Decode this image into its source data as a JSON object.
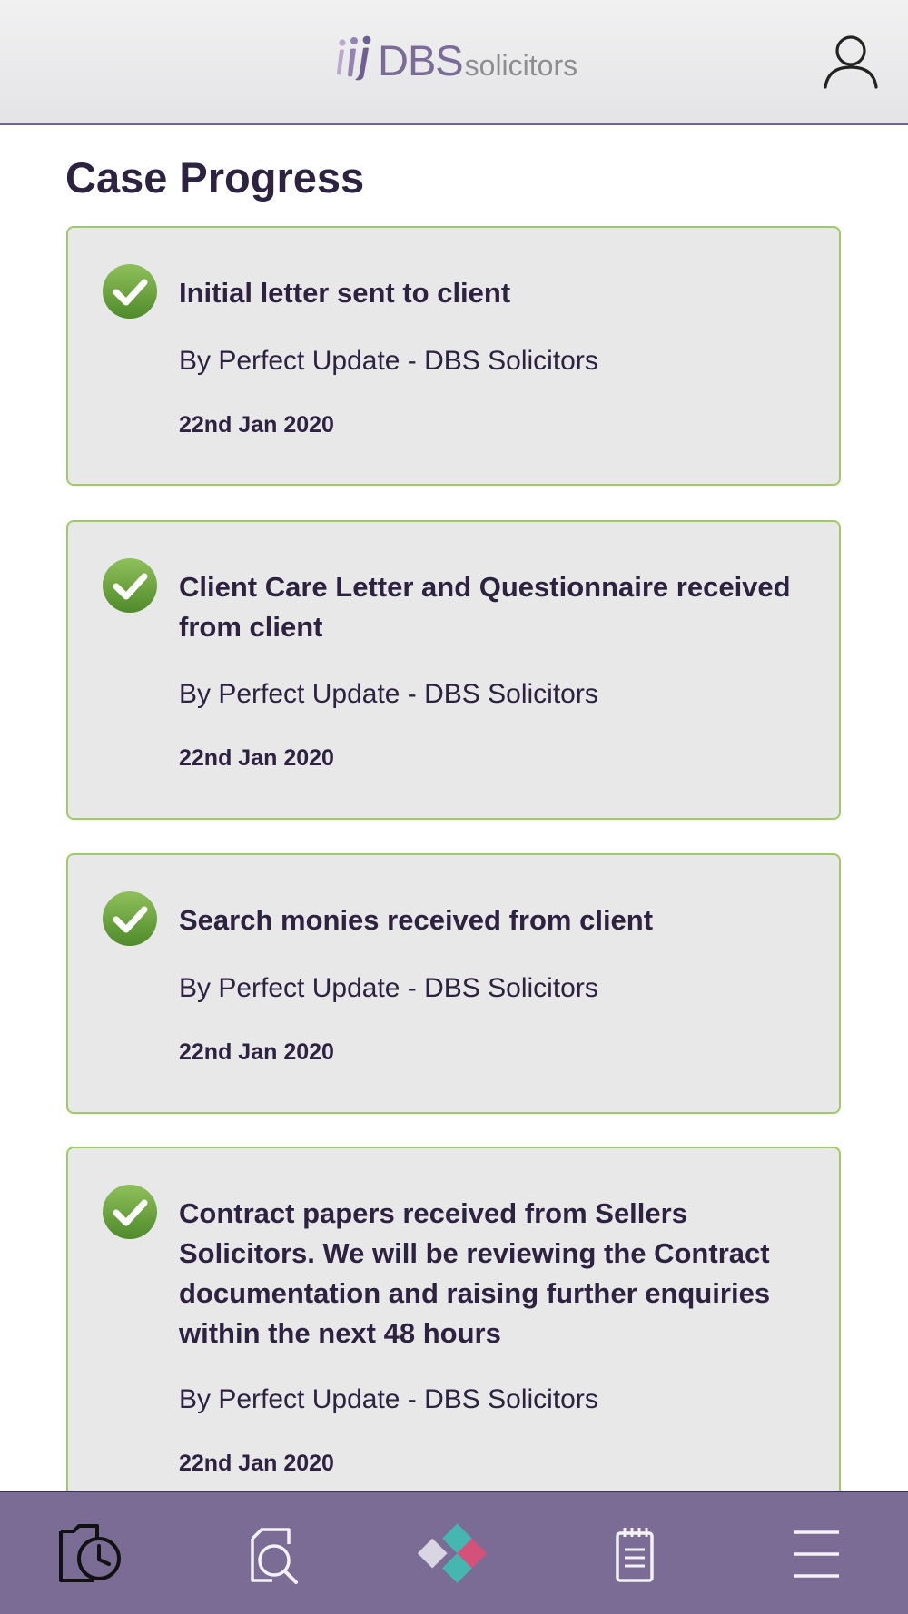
{
  "header": {
    "logo_main": "DBS",
    "logo_sub": "solicitors"
  },
  "page": {
    "title": "Case Progress"
  },
  "cards": [
    {
      "title": "Initial letter sent to client",
      "by": "By Perfect Update - DBS Solicitors",
      "date": "22nd Jan 2020",
      "status": "complete"
    },
    {
      "title": "Client Care Letter and Questionnaire received from client",
      "by": "By Perfect Update - DBS Solicitors",
      "date": "22nd Jan 2020",
      "status": "complete"
    },
    {
      "title": "Search monies received from client",
      "by": "By Perfect Update - DBS Solicitors",
      "date": "22nd Jan 2020",
      "status": "complete"
    },
    {
      "title": "Contract papers received from Sellers Solicitors. We will be reviewing the Contract documentation and raising further enquiries within the next 48 hours",
      "by": "By Perfect Update - DBS Solicitors",
      "date": "22nd Jan 2020",
      "status": "complete"
    }
  ],
  "bottom_nav": {
    "items": [
      {
        "icon": "case-history-icon"
      },
      {
        "icon": "document-search-icon"
      },
      {
        "icon": "brand-diamonds-icon"
      },
      {
        "icon": "notepad-icon"
      },
      {
        "icon": "hamburger-menu-icon"
      }
    ]
  },
  "colors": {
    "header_bg": "#e9e9eb",
    "brand_purple": "#7b6b97",
    "nav_bg": "#7a6c95",
    "card_bg": "#e8e8e9",
    "card_border": "#9ecb67",
    "check_green": "#6aa43c",
    "text_dark": "#2d2340"
  }
}
